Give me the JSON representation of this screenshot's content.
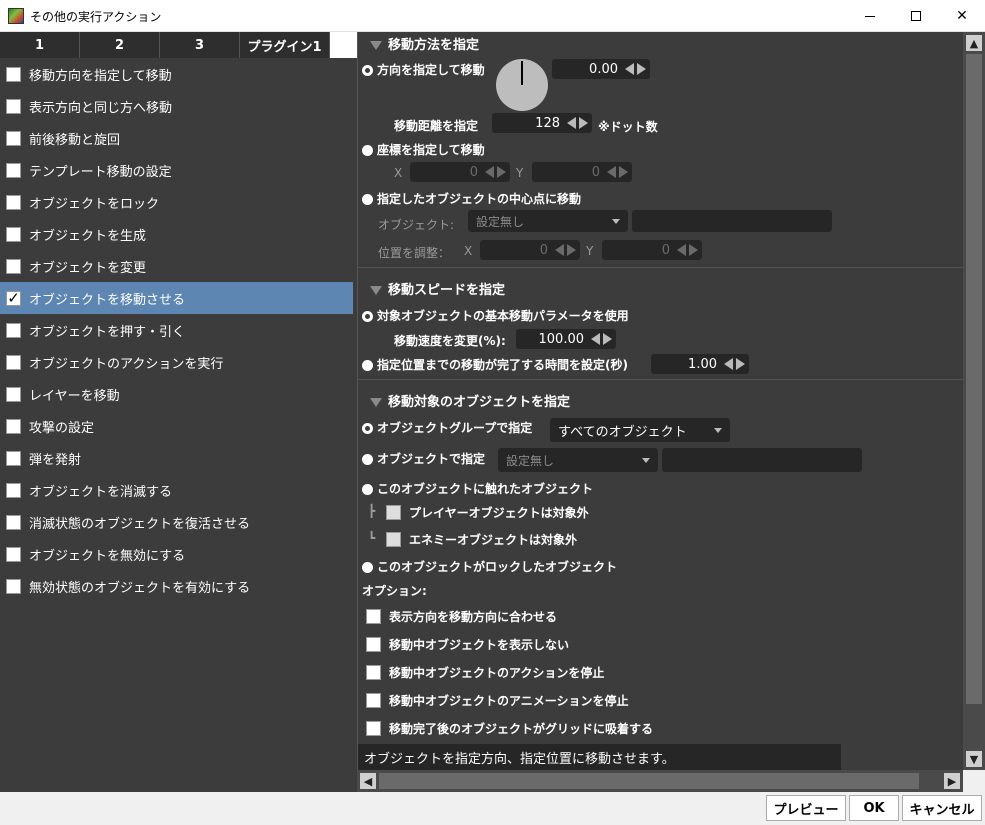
{
  "window": {
    "title": "その他の実行アクション"
  },
  "tabs": [
    {
      "label": "1"
    },
    {
      "label": "2"
    },
    {
      "label": "3"
    },
    {
      "label": "プラグイン1"
    }
  ],
  "actions": [
    {
      "label": "移動方向を指定して移動",
      "checked": false
    },
    {
      "label": "表示方向と同じ方へ移動",
      "checked": false
    },
    {
      "label": "前後移動と旋回",
      "checked": false
    },
    {
      "label": "テンプレート移動の設定",
      "checked": false
    },
    {
      "label": "オブジェクトをロック",
      "checked": false
    },
    {
      "label": "オブジェクトを生成",
      "checked": false
    },
    {
      "label": "オブジェクトを変更",
      "checked": false
    },
    {
      "label": "オブジェクトを移動させる",
      "checked": true,
      "check_mark": "✓"
    },
    {
      "label": "オブジェクトを押す・引く",
      "checked": false
    },
    {
      "label": "オブジェクトのアクションを実行",
      "checked": false
    },
    {
      "label": "レイヤーを移動",
      "checked": false
    },
    {
      "label": "攻撃の設定",
      "checked": false
    },
    {
      "label": "弾を発射",
      "checked": false
    },
    {
      "label": "オブジェクトを消滅する",
      "checked": false
    },
    {
      "label": "消滅状態のオブジェクトを復活させる",
      "checked": false
    },
    {
      "label": "オブジェクトを無効にする",
      "checked": false
    },
    {
      "label": "無効状態のオブジェクトを有効にする",
      "checked": false
    }
  ],
  "move_method": {
    "header": "移動方法を指定",
    "direction_radio": "方向を指定して移動",
    "direction_value": "0.00",
    "distance_label": "移動距離を指定",
    "distance_value": "128",
    "distance_unit": "※ドット数",
    "coord_radio": "座標を指定して移動",
    "x_label": "X",
    "x_value": "0",
    "y_label": "Y",
    "y_value": "0",
    "center_radio": "指定したオブジェクトの中心点に移動",
    "object_label": "オブジェクト:",
    "object_value": "設定無し",
    "position_label": "位置を調整：",
    "pos_x_label": "X",
    "pos_x_value": "0",
    "pos_y_label": "Y",
    "pos_y_value": "0"
  },
  "move_speed": {
    "header": "移動スピードを指定",
    "basic_radio": "対象オブジェクトの基本移動パラメータを使用",
    "speed_label": "移動速度を変更(%):",
    "speed_value": "100.00",
    "time_radio": "指定位置までの移動が完了する時間を設定(秒)",
    "time_value": "1.00"
  },
  "move_target": {
    "header": "移動対象のオブジェクトを指定",
    "group_radio": "オブジェクトグループで指定",
    "group_value": "すべてのオブジェクト",
    "object_radio": "オブジェクトで指定",
    "object_value": "設定無し",
    "touched_radio": "このオブジェクトに触れたオブジェクト",
    "exclude_player": "プレイヤーオブジェクトは対象外",
    "exclude_enemy": "エネミーオブジェクトは対象外",
    "locked_radio": "このオブジェクトがロックしたオブジェクト"
  },
  "options": {
    "label": "オプション:",
    "items": [
      {
        "label": "表示方向を移動方向に合わせる"
      },
      {
        "label": "移動中オブジェクトを表示しない"
      },
      {
        "label": "移動中オブジェクトのアクションを停止"
      },
      {
        "label": "移動中オブジェクトのアニメーションを停止"
      },
      {
        "label": "移動完了後のオブジェクトがグリッドに吸着する"
      }
    ]
  },
  "description": "オブジェクトを指定方向、指定位置に移動させます。",
  "buttons": {
    "preview": "プレビュー",
    "ok": "OK",
    "cancel": "キャンセル"
  },
  "icons": {
    "app": "app-icon",
    "minimize": "minimize-icon",
    "maximize": "maximize-icon",
    "close": "close-icon",
    "close_glyph": "✕",
    "scroll_up": "▲",
    "scroll_down": "▼",
    "scroll_left": "◀",
    "scroll_right": "▶"
  }
}
